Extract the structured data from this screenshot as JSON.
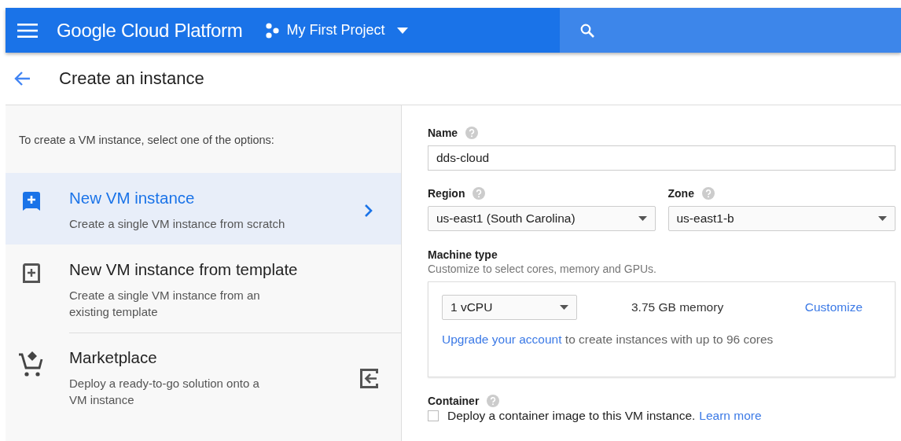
{
  "header": {
    "brand": "Google Cloud Platform",
    "project": "My First Project"
  },
  "page": {
    "title": "Create an instance"
  },
  "sidebar": {
    "intro": "To create a VM instance, select one of the options:",
    "options": [
      {
        "kind": "new",
        "title": "New VM instance",
        "description": "Create a single VM instance from scratch",
        "selected": true
      },
      {
        "kind": "template",
        "title": "New VM instance from template",
        "description": "Create a single VM instance from an existing template",
        "selected": false
      },
      {
        "kind": "marketplace",
        "title": "Marketplace",
        "description": "Deploy a ready-to-go solution onto a VM instance",
        "selected": false
      }
    ]
  },
  "form": {
    "name": {
      "label": "Name",
      "value": "dds-cloud"
    },
    "region": {
      "label": "Region",
      "value": "us-east1 (South Carolina)"
    },
    "zone": {
      "label": "Zone",
      "value": "us-east1-b"
    },
    "machine_type": {
      "label": "Machine type",
      "hint": "Customize to select cores, memory and GPUs.",
      "cpu": "1 vCPU",
      "memory": "3.75 GB memory",
      "customize": "Customize",
      "upgrade_link": "Upgrade your account",
      "upgrade_text": "to create instances with up to 96 cores"
    },
    "container": {
      "label": "Container",
      "checked": false,
      "text": "Deploy a container image to this VM instance.",
      "link": "Learn more"
    }
  }
}
